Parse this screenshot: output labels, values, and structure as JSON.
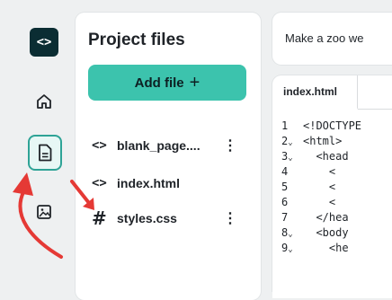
{
  "rail": {
    "logo_glyph": "<>",
    "items": [
      {
        "icon": "home-icon"
      },
      {
        "icon": "file-icon",
        "active": true
      },
      {
        "icon": "image-icon"
      }
    ]
  },
  "panel": {
    "title": "Project files",
    "add_button_label": "Add file",
    "add_button_icon": "+",
    "files": [
      {
        "icon_glyph": "<>",
        "name": "blank_page....",
        "menu": "⋮"
      },
      {
        "icon_glyph": "<>",
        "name": "index.html",
        "menu": ""
      },
      {
        "icon_glyph": "#",
        "name": "styles.css",
        "menu": "⋮"
      }
    ]
  },
  "prompt": {
    "text": "Make a zoo we"
  },
  "editor": {
    "tab_label": "index.html",
    "lines": [
      {
        "num": "1",
        "fold": "",
        "text": "<!DOCTYPE"
      },
      {
        "num": "2",
        "fold": "⌄",
        "text": "<html>"
      },
      {
        "num": "3",
        "fold": "⌄",
        "text": "  <head"
      },
      {
        "num": "4",
        "fold": "",
        "text": "    <"
      },
      {
        "num": "5",
        "fold": "",
        "text": "    <"
      },
      {
        "num": "6",
        "fold": "",
        "text": "    <"
      },
      {
        "num": "7",
        "fold": "",
        "text": "  </hea"
      },
      {
        "num": "8",
        "fold": "⌄",
        "text": "  <body"
      },
      {
        "num": "9",
        "fold": "⌄",
        "text": "    <he"
      }
    ]
  },
  "colors": {
    "accent": "#3cc3ad",
    "logo_bg": "#0b2d33",
    "annotation_arrow": "#e53935"
  }
}
